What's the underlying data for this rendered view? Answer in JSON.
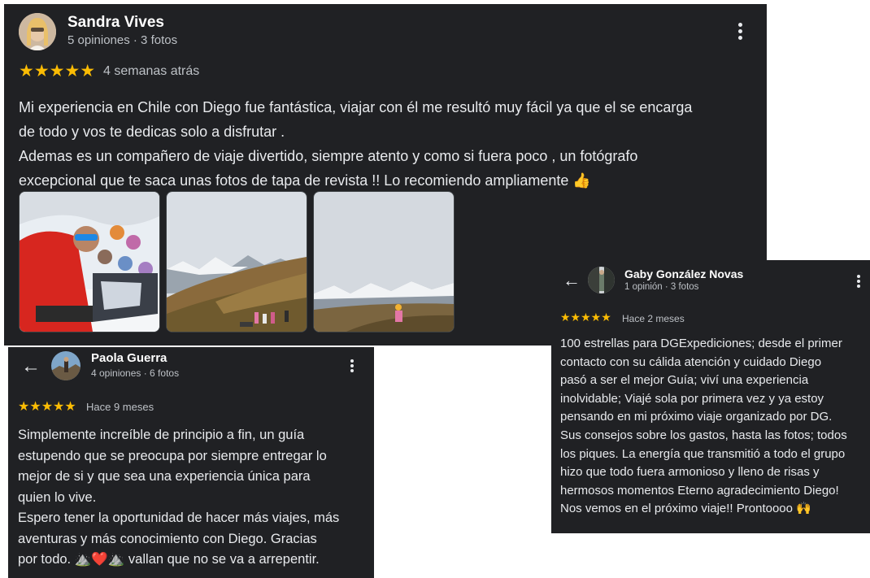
{
  "review1": {
    "name": "Sandra Vives",
    "meta": "5 opiniones · 3 fotos",
    "stars": "★★★★★",
    "when": "4 semanas atrás",
    "text": "Mi experiencia en Chile con Diego fue fantástica, viajar con él me resultó muy fácil ya que el se encarga\nde todo y vos te dedicas solo a disfrutar .\nAdemas es un compañero de viaje divertido, siempre atento y como si fuera poco , un fotógrafo\nexcepcional que te saca unas fotos de tapa de revista !! Lo recomiendo ampliamente 👍",
    "photos": [
      "group-selfie-snow-photo",
      "mountain-valley-group-photo",
      "snowy-peaks-hiker-photo"
    ]
  },
  "review2": {
    "name": "Paola Guerra",
    "meta": "4 opiniones · 6 fotos",
    "stars": "★★★★★",
    "when": "Hace 9 meses",
    "text": "Simplemente increíble de principio a fin, un guía\nestupendo que se preocupa por siempre entregar lo\nmejor de si y que sea una experiencia única para\nquien lo vive.\nEspero tener la oportunidad de hacer más viajes, más\naventuras y más conocimiento con Diego. Gracias\npor todo. ⛰️❤️⛰️ vallan que no se va a arrepentir."
  },
  "review3": {
    "name": "Gaby González Novas",
    "meta": "1 opinión · 3 fotos",
    "stars": "★★★★★",
    "when": "Hace 2 meses",
    "text": "100 estrellas para DGExpediciones; desde el primer\ncontacto con su cálida atención y cuidado Diego\npasó a ser el mejor Guía; viví una experiencia\ninolvidable; Viajé sola por primera vez y ya estoy\npensando en mi próximo viaje organizado por DG.\nSus consejos sobre los gastos, hasta las fotos; todos\nlos piques. La energía que transmitió a todo el grupo\nhizo que todo fuera armonioso y lleno de risas y\nhermosos momentos Eterno agradecimiento Diego!\nNos vemos en el próximo viaje!! Prontoooo 🙌"
  },
  "icons": {
    "back": "←",
    "more": "more-vert-icon"
  },
  "colors": {
    "card_bg": "#202124",
    "star": "#fbbc04",
    "text": "#e8eaed",
    "meta": "#bdc1c6"
  }
}
